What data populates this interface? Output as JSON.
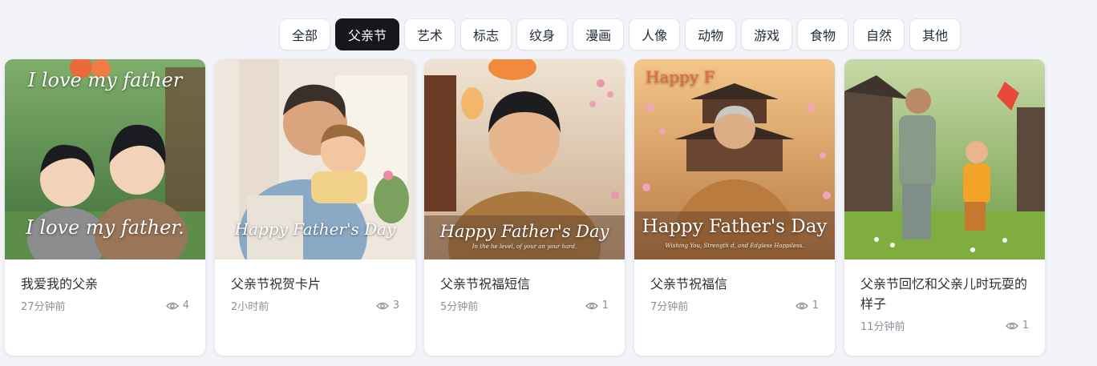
{
  "tabs": [
    {
      "label": "全部",
      "active": false
    },
    {
      "label": "父亲节",
      "active": true
    },
    {
      "label": "艺术",
      "active": false
    },
    {
      "label": "标志",
      "active": false
    },
    {
      "label": "纹身",
      "active": false
    },
    {
      "label": "漫画",
      "active": false
    },
    {
      "label": "人像",
      "active": false
    },
    {
      "label": "动物",
      "active": false
    },
    {
      "label": "游戏",
      "active": false
    },
    {
      "label": "食物",
      "active": false
    },
    {
      "label": "自然",
      "active": false
    },
    {
      "label": "其他",
      "active": false
    }
  ],
  "cards": [
    {
      "title": "我爱我的父亲",
      "time": "27分钟前",
      "views": "4",
      "overlay_top": "I love my father",
      "overlay_bottom": "I love my father."
    },
    {
      "title": "父亲节祝贺卡片",
      "time": "2小时前",
      "views": "3",
      "overlay_bottom": "Happy Father's Day"
    },
    {
      "title": "父亲节祝福短信",
      "time": "5分钟前",
      "views": "1",
      "overlay_bottom": "Happy Father's Day",
      "overlay_sub": "In the he level, of your an your hard."
    },
    {
      "title": "父亲节祝福信",
      "time": "7分钟前",
      "views": "1",
      "overlay_top": "Happy F",
      "overlay_bottom": "Happy Father's Day",
      "overlay_sub": "Wishing You, Strength d, and Edgless Happiless."
    },
    {
      "title": "父亲节回忆和父亲儿时玩耍的样子",
      "time": "11分钟前",
      "views": "1"
    }
  ]
}
